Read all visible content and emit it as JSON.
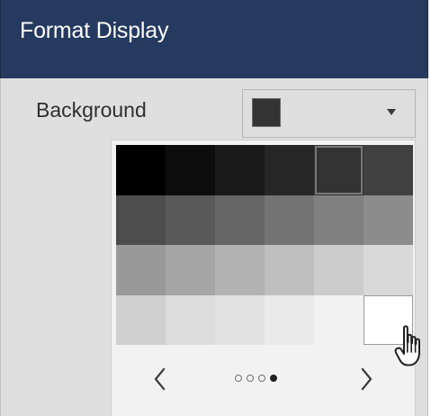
{
  "header": {
    "title": "Format Display"
  },
  "background": {
    "label": "Background",
    "selected_color": "#333333"
  },
  "palette": {
    "rows": [
      [
        "#000000",
        "#0d0d0d",
        "#1a1a1a",
        "#262626",
        "#333333",
        "#404040"
      ],
      [
        "#4d4d4d",
        "#595959",
        "#666666",
        "#737373",
        "#808080",
        "#8c8c8c"
      ],
      [
        "#999999",
        "#a6a6a6",
        "#b3b3b3",
        "#bfbfbf",
        "#cccccc",
        "#d9d9d9"
      ],
      [
        "#cfcfcf",
        "#dcdcdc",
        "#e2e2e2",
        "#eaeaea",
        "#f2f2f2",
        "#ffffff"
      ]
    ],
    "selected_index": 4,
    "hover_index": 23
  },
  "navigation": {
    "prev_icon": "chevron-left-icon",
    "next_icon": "chevron-right-icon",
    "page_dots": [
      "inactive",
      "inactive",
      "inactive",
      "active"
    ]
  },
  "pointer": {
    "icon": "hand-pointer-icon"
  }
}
